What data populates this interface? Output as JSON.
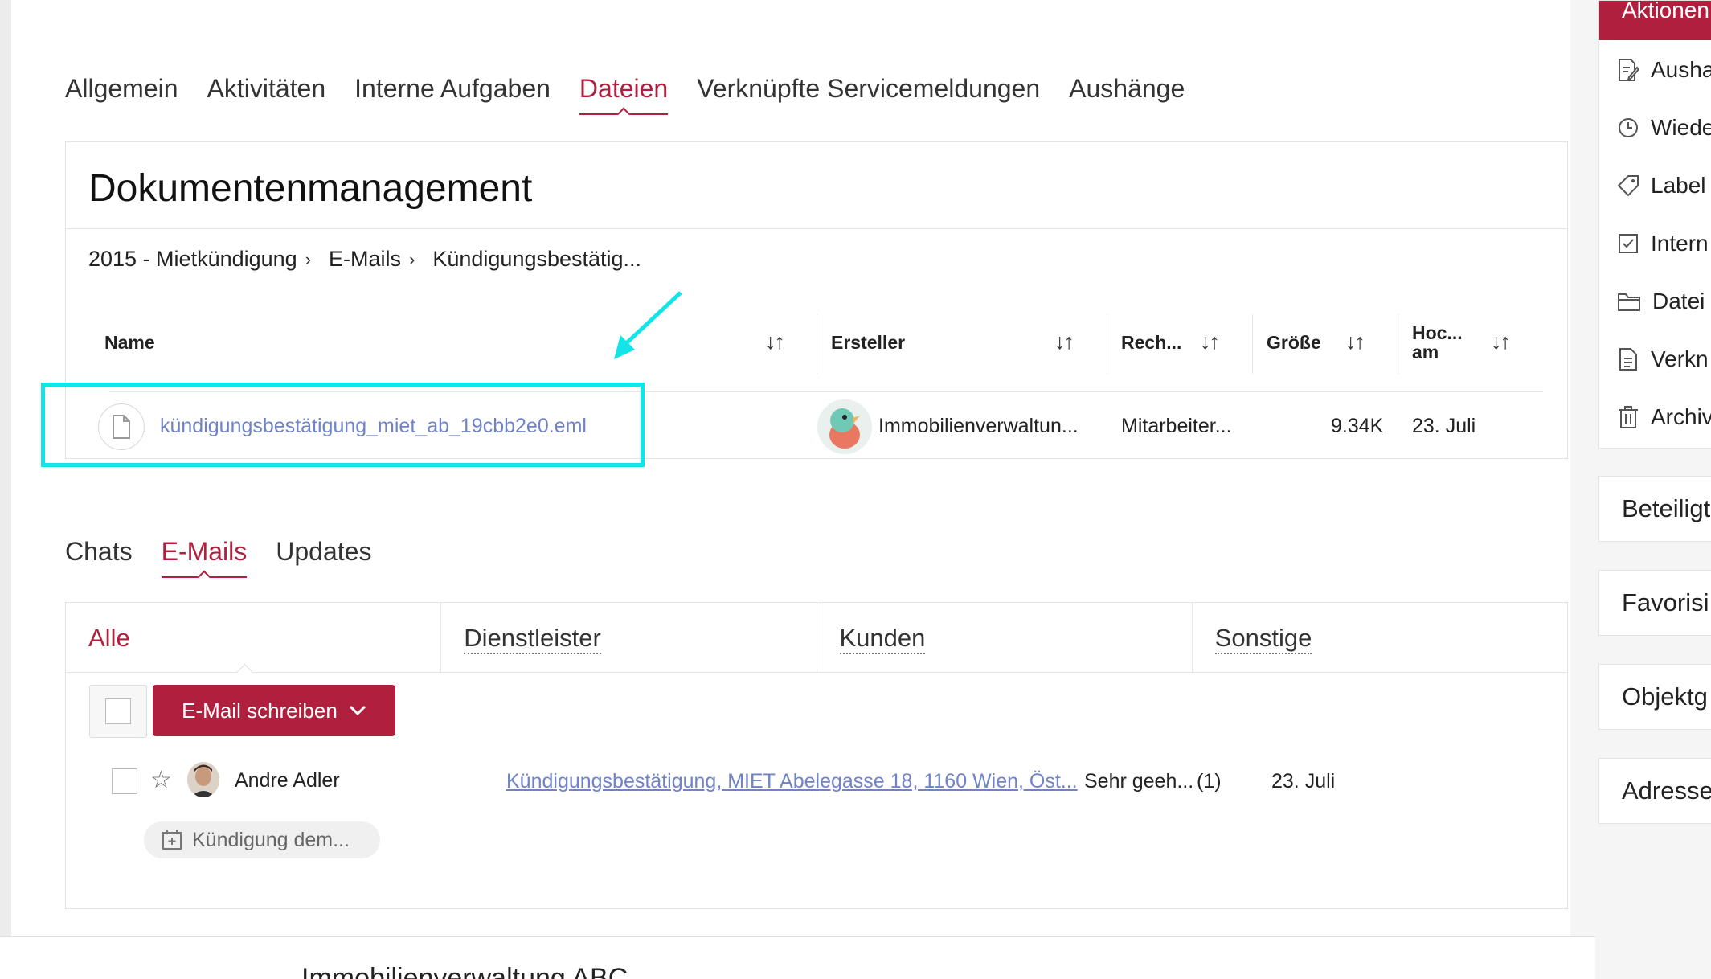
{
  "tabs": [
    {
      "label": "Allgemein",
      "active": false
    },
    {
      "label": "Aktivitäten",
      "active": false
    },
    {
      "label": "Interne Aufgaben",
      "active": false
    },
    {
      "label": "Dateien",
      "active": true
    },
    {
      "label": "Verknüpfte Servicemeldungen",
      "active": false
    },
    {
      "label": "Aushänge",
      "active": false
    }
  ],
  "documents": {
    "title": "Dokumentenmanagement",
    "breadcrumb": [
      "2015 - Mietkündigung",
      "E-Mails",
      "Kündigungsbestätig..."
    ],
    "columns": {
      "name": "Name",
      "creator": "Ersteller",
      "rights": "Rech...",
      "size": "Größe",
      "uploaded_line1": "Hoc...",
      "uploaded_line2": "am"
    },
    "sort_glyph": "↓↑",
    "file": {
      "name": "kündigungsbestätigung_miet_ab_19cbb2e0.eml",
      "creator": "Immobilienverwaltun...",
      "rights": "Mitarbeiter...",
      "size": "9.34K",
      "date": "23. Juli"
    }
  },
  "comm_tabs": [
    {
      "label": "Chats",
      "active": false
    },
    {
      "label": "E-Mails",
      "active": true
    },
    {
      "label": "Updates",
      "active": false
    }
  ],
  "mail": {
    "subtabs": [
      {
        "label": "Alle",
        "active": true
      },
      {
        "label": "Dienstleister",
        "active": false
      },
      {
        "label": "Kunden",
        "active": false
      },
      {
        "label": "Sonstige",
        "active": false
      }
    ],
    "write_button": "E-Mail schreiben",
    "row": {
      "sender": "Andre Adler",
      "subject": "Kündigungsbestätigung, MIET Abelegasse 18, 1160 Wien, Öst...",
      "snippet": "Sehr geeh...",
      "count": "(1)",
      "date": "23. Juli",
      "tag": "Kündigung dem..."
    }
  },
  "sidebar": {
    "actions_title": "Aktionen",
    "actions": [
      {
        "label": "Ausha",
        "icon": "edit-document-icon"
      },
      {
        "label": "Wiede",
        "icon": "clock-icon"
      },
      {
        "label": "Label",
        "icon": "tag-icon"
      },
      {
        "label": "Intern",
        "icon": "checkbox-icon"
      },
      {
        "label": "Datei",
        "icon": "folder-icon"
      },
      {
        "label": "Verkn",
        "icon": "document-icon"
      },
      {
        "label": "Archiv",
        "icon": "trash-icon"
      }
    ],
    "sections": [
      "Beteiligt",
      "Favorisi",
      "Objektg",
      "Adresse"
    ]
  },
  "footer_text": "Immobilienverwaltung ABC",
  "colors": {
    "accent": "#b0203e",
    "link": "#6f83c6",
    "highlight": "#12e4e8"
  }
}
